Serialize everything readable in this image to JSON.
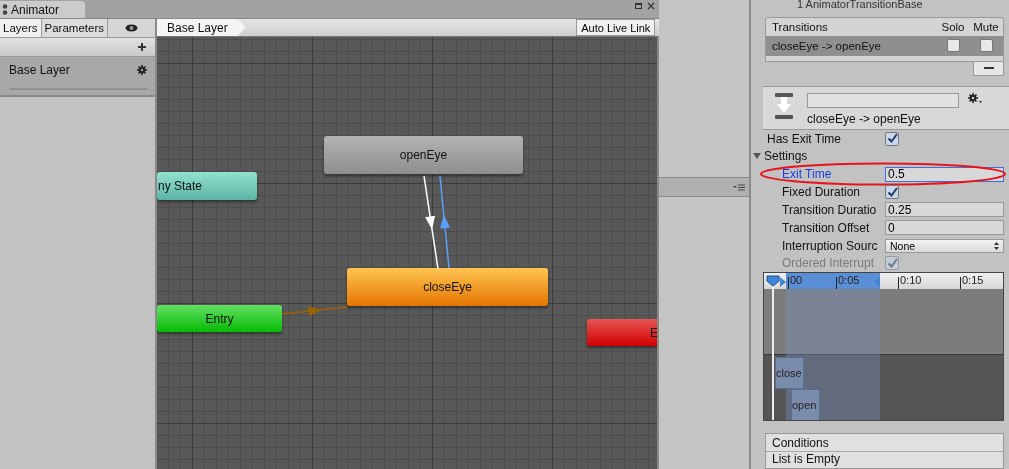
{
  "window": {
    "title": "Animator"
  },
  "left_panel": {
    "tabs": [
      {
        "label": "Layers",
        "selected": true
      },
      {
        "label": "Parameters",
        "selected": false
      }
    ],
    "layers": [
      {
        "name": "Base Layer",
        "selected": true
      }
    ]
  },
  "breadcrumb": "Base Layer",
  "auto_live_link": {
    "label": "Auto Live Link",
    "on": false
  },
  "graph": {
    "states": [
      {
        "name": "openEye",
        "kind": "normal"
      },
      {
        "name": "ny State",
        "kind": "any"
      },
      {
        "name": "closeEye",
        "kind": "default"
      },
      {
        "name": "Entry",
        "kind": "entry"
      },
      {
        "name": "E",
        "kind": "exit"
      }
    ],
    "transitions": [
      {
        "kind": "state",
        "selected": false
      },
      {
        "kind": "state",
        "selected": true
      },
      {
        "kind": "entry",
        "selected": false
      }
    ]
  },
  "inspector": {
    "header": "1 AnimatorTransitionBase",
    "transitions_list": {
      "columns": [
        "Transitions",
        "Solo",
        "Mute"
      ],
      "rows": [
        {
          "name": "closeEye -> openEye",
          "solo": false,
          "mute": false,
          "selected": true
        }
      ]
    },
    "transition": {
      "title": "closeEye -> openEye"
    },
    "has_exit_time": {
      "label": "Has Exit Time",
      "checked": true
    },
    "settings": {
      "label": "Settings",
      "expanded": true,
      "fields": [
        {
          "kind": "number",
          "label": "Exit Time",
          "value": "0.5",
          "focused": true
        },
        {
          "kind": "checkbox",
          "label": "Fixed Duration",
          "checked": true,
          "disabled": false
        },
        {
          "kind": "number",
          "label": "Transition Duratio",
          "value": "0.25",
          "focused": false
        },
        {
          "kind": "number",
          "label": "Transition Offset",
          "value": "0",
          "focused": false
        },
        {
          "kind": "dropdown",
          "label": "Interruption Sourc",
          "value": "None"
        },
        {
          "kind": "checkbox",
          "label": "Ordered Interrupt",
          "checked": true,
          "disabled": true
        }
      ]
    },
    "timeline": {
      "ticks": [
        "00",
        "0:05",
        "0:10",
        "0:15"
      ],
      "clips": [
        "close",
        "open"
      ]
    },
    "conditions": {
      "title": "Conditions",
      "empty_text": "List is Empty"
    }
  }
}
